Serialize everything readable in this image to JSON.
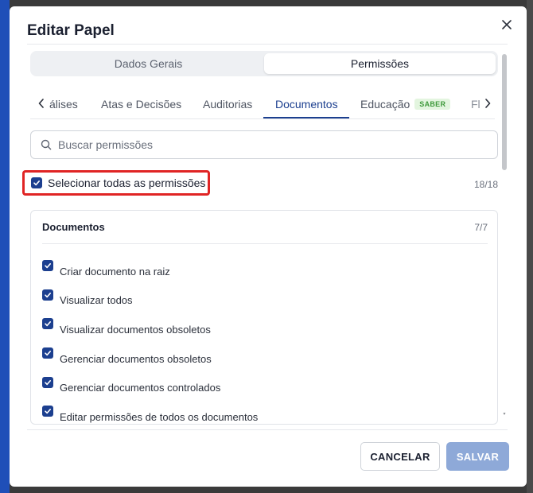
{
  "modal": {
    "title": "Editar Papel",
    "close_icon": "close-icon"
  },
  "segment_tabs": [
    {
      "label": "Dados Gerais",
      "active": false
    },
    {
      "label": "Permissões",
      "active": true
    }
  ],
  "category_tabs": {
    "items": [
      {
        "label": "álises",
        "active": false
      },
      {
        "label": "Atas e Decisões",
        "active": false
      },
      {
        "label": "Auditorias",
        "active": false
      },
      {
        "label": "Documentos",
        "active": true
      },
      {
        "label": "Educação",
        "active": false,
        "badge": "SABER"
      },
      {
        "label": "Fl",
        "active": false
      }
    ],
    "left_arrow_icon": "chevron-left-icon",
    "right_arrow_icon": "chevron-right-icon"
  },
  "search": {
    "placeholder": "Buscar permissões",
    "value": "",
    "icon": "search-icon"
  },
  "select_all": {
    "label": "Selecionar todas as permissões",
    "checked": true,
    "count": "18/18"
  },
  "permission_group": {
    "title": "Documentos",
    "count": "7/7",
    "items": [
      {
        "label": "Criar documento na raiz",
        "checked": true
      },
      {
        "label": "Visualizar todos",
        "checked": true
      },
      {
        "label": "Visualizar documentos obsoletos",
        "checked": true
      },
      {
        "label": "Gerenciar documentos obsoletos",
        "checked": true
      },
      {
        "label": "Gerenciar documentos controlados",
        "checked": true
      },
      {
        "label": "Editar permissões de todos os documentos",
        "checked": true
      }
    ]
  },
  "footer": {
    "cancel_label": "CANCELAR",
    "save_label": "SALVAR"
  },
  "colors": {
    "accent": "#1c3f8f",
    "highlight_border": "#e02424",
    "save_disabled": "#8ea9d8",
    "badge_text": "#3f9a3c",
    "badge_bg": "#e3f5df"
  }
}
